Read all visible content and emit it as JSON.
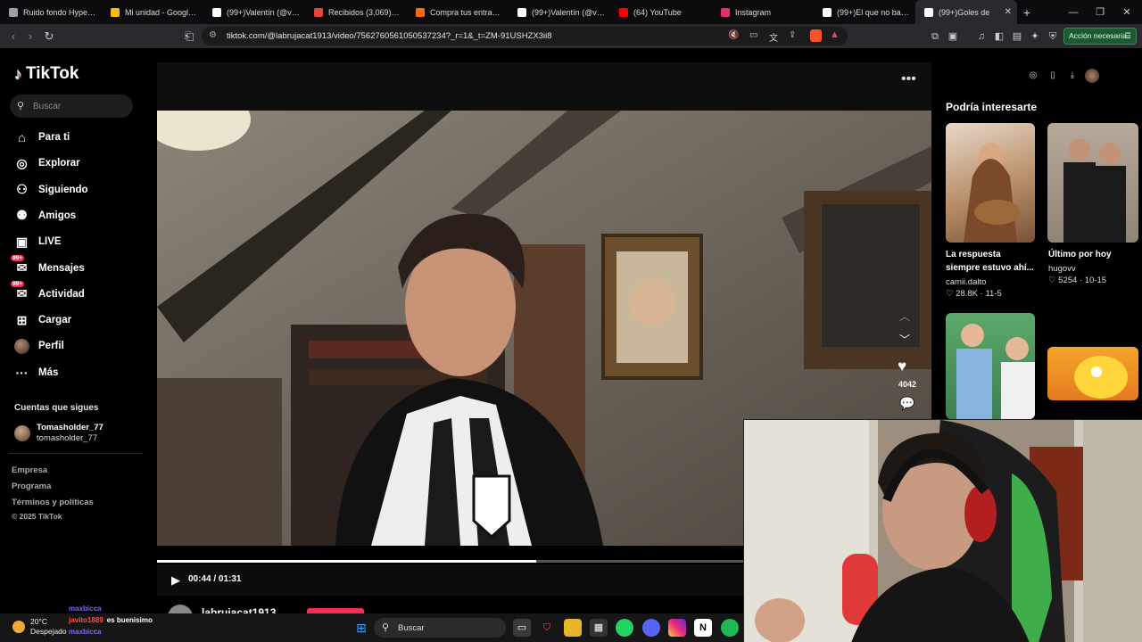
{
  "browser": {
    "tabs": [
      {
        "title": "Ruido fondo HyperX C",
        "color": "#9aa0a6"
      },
      {
        "title": "Mi unidad - Google Dr",
        "color": "#fbbc04"
      },
      {
        "title": "(99+)Valentín (@valen",
        "color": "#ffffff"
      },
      {
        "title": "Recibidos (3,069) - cor",
        "color": "#ea4335"
      },
      {
        "title": "Compra tus entradas p",
        "color": "#ff6d00"
      },
      {
        "title": "(99+)Valentín (@valen",
        "color": "#ffffff"
      },
      {
        "title": "(64) YouTube",
        "color": "#ff0000"
      },
      {
        "title": "Instagram",
        "color": "#e1306c"
      },
      {
        "title": "(99+)El que no baila n",
        "color": "#ffffff"
      },
      {
        "title": "(99+)Goles de",
        "color": "#ffffff",
        "active": true
      }
    ],
    "new_tab": "+",
    "url": "tiktok.com/@labrujacat1913/video/7562760561050537234?_r=1&_t=ZM-91USHZX3ii8",
    "action_button": "Acción necesaria"
  },
  "tiktok": {
    "logo": "TikTok",
    "search_placeholder": "Buscar",
    "nav": [
      {
        "label": "Para ti",
        "icon": "home-icon"
      },
      {
        "label": "Explorar",
        "icon": "compass-icon"
      },
      {
        "label": "Siguiendo",
        "icon": "following-icon"
      },
      {
        "label": "Amigos",
        "icon": "friends-icon"
      },
      {
        "label": "LIVE",
        "icon": "live-icon"
      },
      {
        "label": "Mensajes",
        "icon": "messages-icon",
        "badge": "99+"
      },
      {
        "label": "Actividad",
        "icon": "activity-icon",
        "badge": "99+"
      },
      {
        "label": "Cargar",
        "icon": "upload-icon"
      },
      {
        "label": "Perfil",
        "icon": "profile-icon"
      },
      {
        "label": "Más",
        "icon": "more-icon"
      }
    ],
    "following_title": "Cuentas que sigues",
    "following": {
      "name": "Tomasholder_77",
      "handle": "tomasholder_77"
    },
    "footer": [
      "Empresa",
      "Programa",
      "Términos y políticas",
      "© 2025 TikTok"
    ],
    "player": {
      "time": "00:44 / 01:31",
      "progress": 0.49,
      "likes": "4042",
      "author": "labrujacat1913"
    },
    "recommended_title": "Podría interesarte",
    "cards": [
      {
        "title": "La respuesta siempre estuvo ahí...",
        "user": "camii.dalto",
        "likes": "28.8K",
        "date": "11-5"
      },
      {
        "title": "Último por hoy",
        "user": "hugovv",
        "likes": "5254",
        "date": "10-15"
      }
    ]
  },
  "taskbar": {
    "weather_temp": "20°C",
    "weather_text": "Despejado",
    "search": "Buscar",
    "chat": [
      {
        "user": "maxbicca",
        "msg": "",
        "color": "#7b6bff"
      },
      {
        "user": "javito1889",
        "msg": "es buenisimo",
        "color": "#ff4d4d"
      },
      {
        "user": "maxbicca",
        "msg": "",
        "color": "#7b6bff"
      }
    ]
  }
}
